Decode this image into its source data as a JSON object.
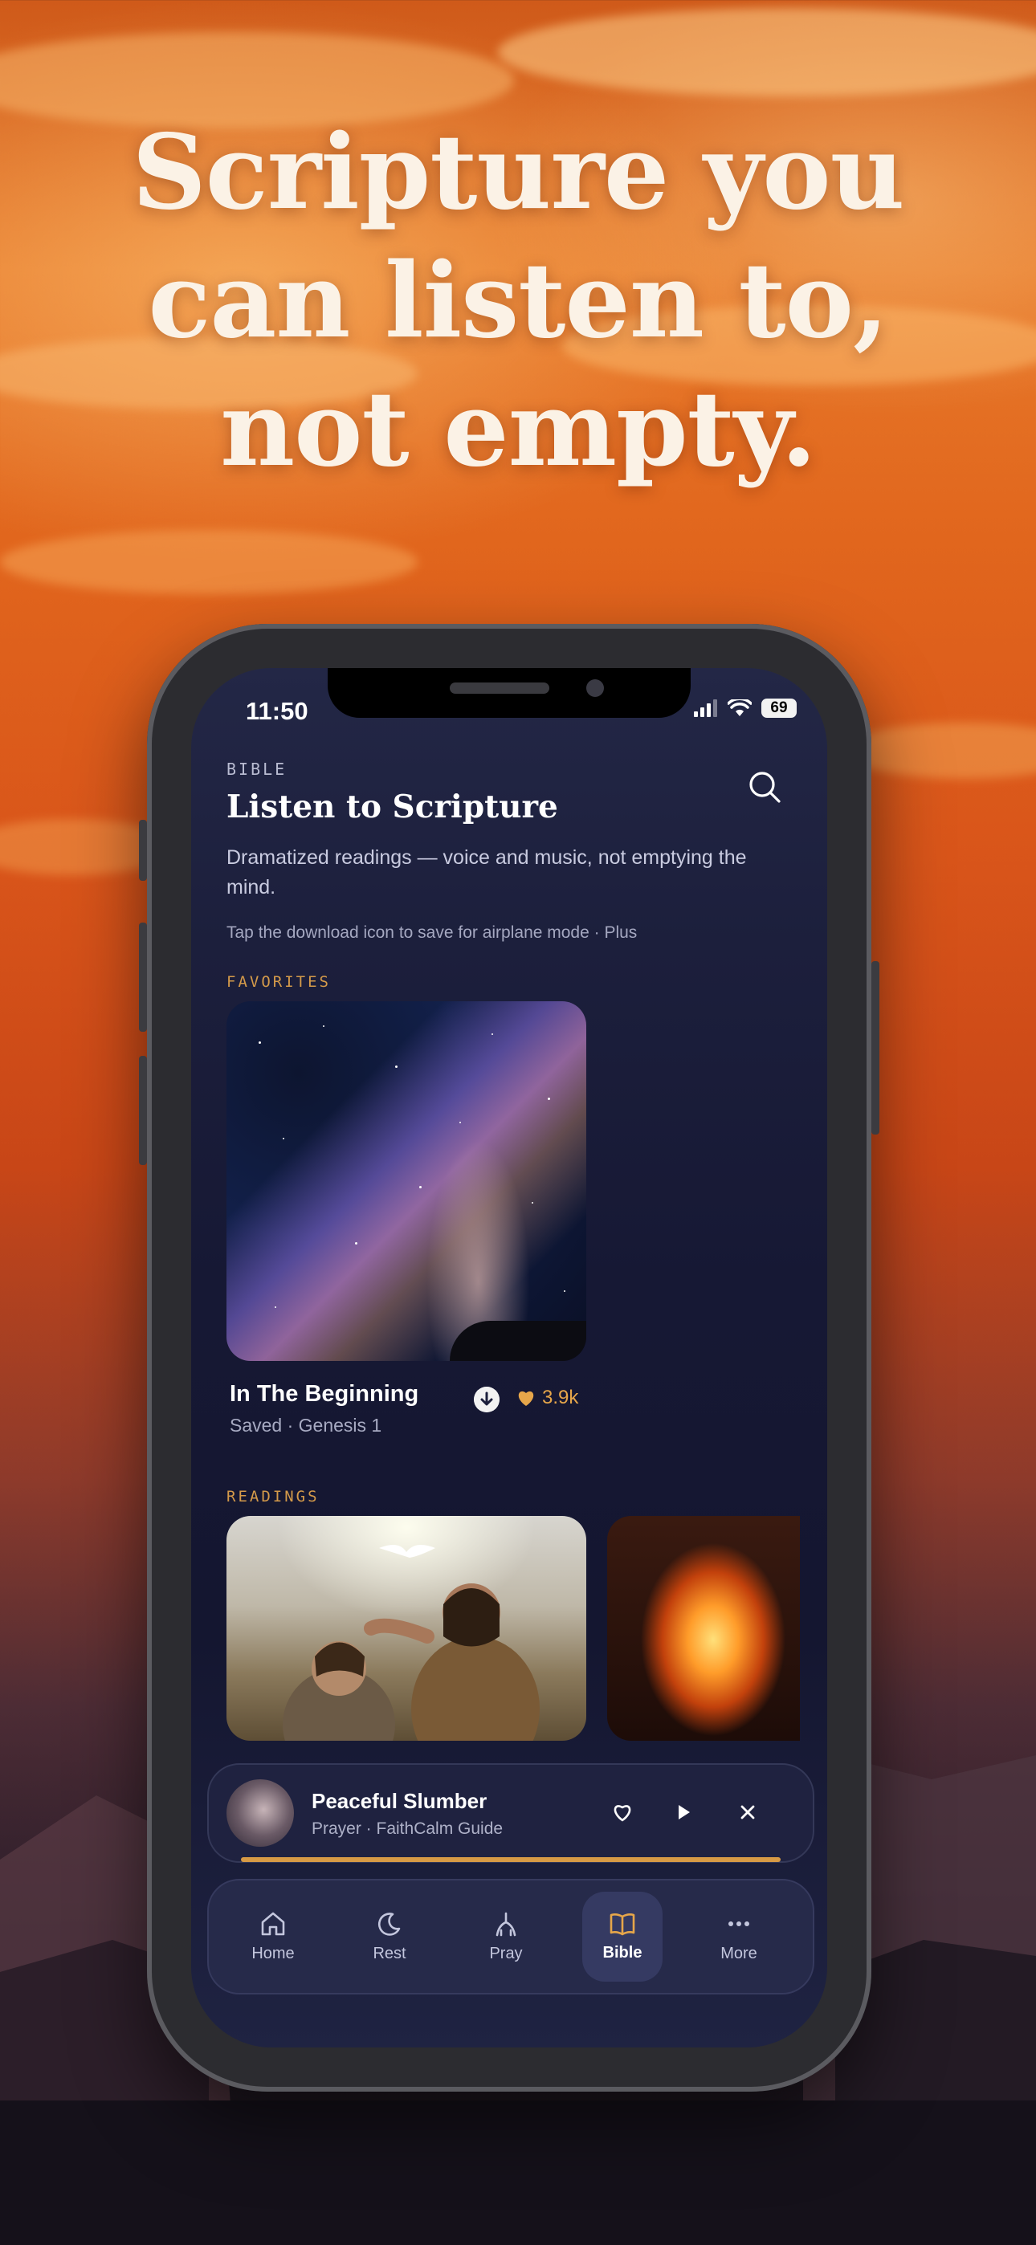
{
  "hero": {
    "line1": "Scripture you",
    "line2": "can listen to,",
    "line3": "not empty."
  },
  "status_bar": {
    "time": "11:50",
    "battery": "69"
  },
  "header": {
    "eyebrow": "BIBLE",
    "title": "Listen to Scripture",
    "subtitle": "Dramatized readings — voice and music, not emptying the mind.",
    "hint": "Tap the download icon to save for airplane mode · Plus"
  },
  "favorites": {
    "label": "FAVORITES",
    "item": {
      "title": "In The Beginning",
      "meta": "Saved · Genesis 1",
      "likes": "3.9k"
    }
  },
  "readings": {
    "label": "READINGS"
  },
  "player": {
    "title": "Peaceful Slumber",
    "subtitle": "Prayer · FaithCalm Guide",
    "progress": 1.0
  },
  "tabs": [
    {
      "label": "Home",
      "icon": "home-icon"
    },
    {
      "label": "Rest",
      "icon": "moon-icon"
    },
    {
      "label": "Pray",
      "icon": "pray-icon"
    },
    {
      "label": "Bible",
      "icon": "book-icon",
      "active": true
    },
    {
      "label": "More",
      "icon": "more-icon"
    }
  ],
  "colors": {
    "accent": "#e6a64a",
    "screen_bg": "#161834",
    "headline": "#fbf2e6"
  }
}
